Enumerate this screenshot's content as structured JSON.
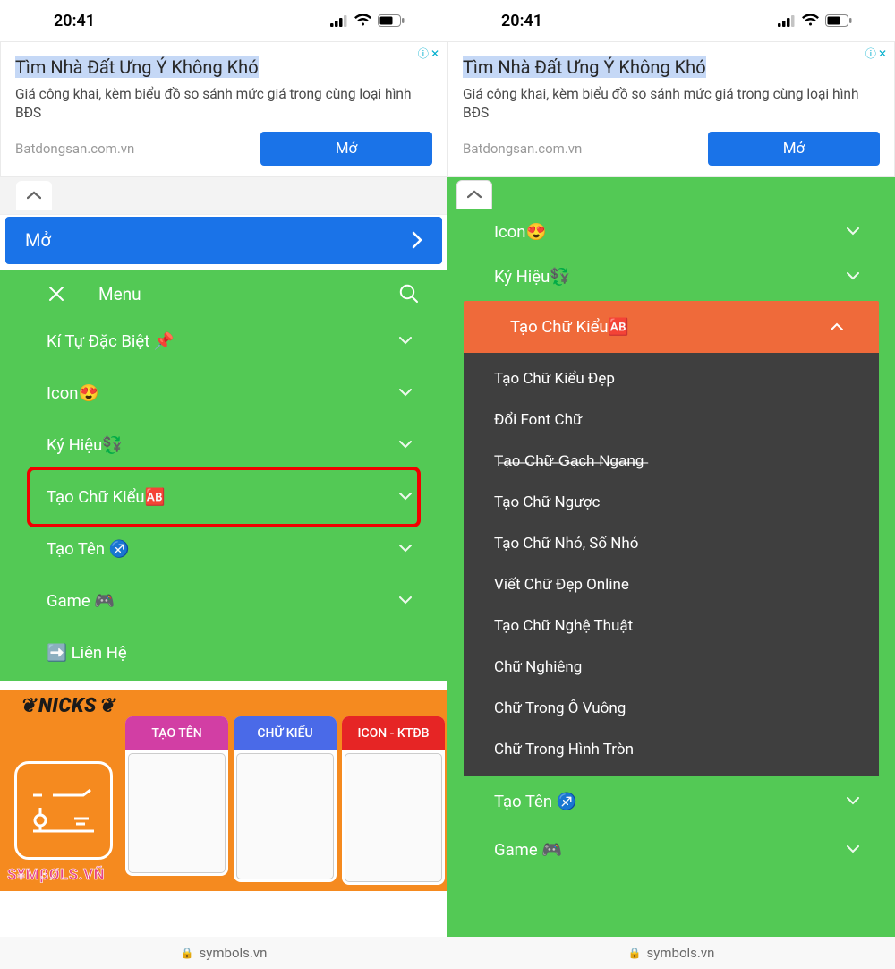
{
  "status": {
    "time": "20:41"
  },
  "ad": {
    "title": "Tìm Nhà Đất Ưng Ý Không Khó",
    "subtitle": "Giá công khai, kèm biểu đồ so sánh mức giá trong cùng loại hình BĐS",
    "domain": "Batdongsan.com.vn",
    "button": "Mở",
    "info": "ⓘ",
    "close": "✕"
  },
  "mo_bar": {
    "label": "Mở"
  },
  "menu": {
    "title": "Menu",
    "items": [
      {
        "label": "Kí Tự Đặc Biệt 📌"
      },
      {
        "label": "Icon😍"
      },
      {
        "label": "Ký Hiệu💱"
      },
      {
        "label": "Tạo Chữ Kiểu🆎"
      },
      {
        "label": "Tạo Tên ♐"
      },
      {
        "label": "Game 🎮"
      },
      {
        "label": "➡️ Liên Hệ"
      }
    ]
  },
  "right_menu": {
    "pre": [
      {
        "label": "Icon😍"
      },
      {
        "label": "Ký Hiệu💱"
      }
    ],
    "active": "Tạo Chữ Kiểu🆎",
    "dropdown": [
      "Tạo Chữ Kiểu Đẹp",
      "Đổi Font Chữ",
      "T̶ạ̶o̶ ̶C̶h̶ữ̶ ̶G̶ạ̶c̶h̶ ̶N̶g̶a̶n̶g̶",
      "Tạo Chữ Ngược",
      "Tạo Chữ Nhỏ, Số Nhỏ",
      "Viết Chữ Đẹp Online",
      "Tạo Chữ Nghệ Thuật",
      "Chữ Nghiêng",
      "Chữ Trong Ô Vuông",
      "Chữ Trong Hình Tròn"
    ],
    "post": [
      {
        "label": "Tạo Tên ♐"
      },
      {
        "label": "Game 🎮"
      }
    ]
  },
  "nicks": {
    "title": "NICKS",
    "brand": "S¥MβØLS.VÑ",
    "screens": [
      "TẠO TÊN",
      "CHỮ KIỂU",
      "ICON - KTĐB"
    ]
  },
  "footer": {
    "domain": "symbols.vn"
  }
}
